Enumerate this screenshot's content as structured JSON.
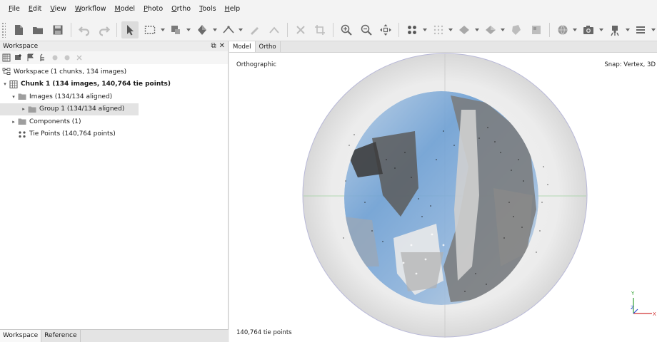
{
  "menu": [
    "File",
    "Edit",
    "View",
    "Workflow",
    "Model",
    "Photo",
    "Ortho",
    "Tools",
    "Help"
  ],
  "toolbar": {
    "icons": [
      "new-file-icon",
      "open-folder-icon",
      "save-icon",
      "undo-icon",
      "redo-icon",
      "navigation-arrow-icon",
      "rectangle-selection-icon",
      "shape-tool-icon",
      "draw-polygon-icon",
      "ruler-icon",
      "brush-icon",
      "angle-icon",
      "delete-icon",
      "crop-icon",
      "zoom-in-icon",
      "zoom-out-icon",
      "move-icon",
      "point-cloud-icon",
      "grid-dots-icon",
      "mesh-icon",
      "texture-icon",
      "tiled-model-icon",
      "dem-icon",
      "globe-icon",
      "camera-icon",
      "drone-icon",
      "menu-lines-icon"
    ]
  },
  "workspace": {
    "title": "Workspace",
    "root": "Workspace (1 chunks, 134 images)",
    "chunk": "Chunk 1 (134 images, 140,764 tie points)",
    "images": "Images (134/134 aligned)",
    "group": "Group 1 (134/134 aligned)",
    "components": "Components (1)",
    "tie_points": "Tie Points (140,764 points)"
  },
  "bottom_tabs": [
    "Workspace",
    "Reference"
  ],
  "viewport": {
    "tabs": [
      "Model",
      "Ortho"
    ],
    "projection": "Orthographic",
    "snap": "Snap: Vertex, 3D",
    "status": "140,764 tie points",
    "axis_y": "Y",
    "axis_z": "Z",
    "axis_x": "X"
  },
  "colors": {
    "axis_x": "#d03030",
    "axis_y": "#30a030",
    "axis_z": "#3050d0",
    "sky_blue": "#6aa2d8"
  }
}
